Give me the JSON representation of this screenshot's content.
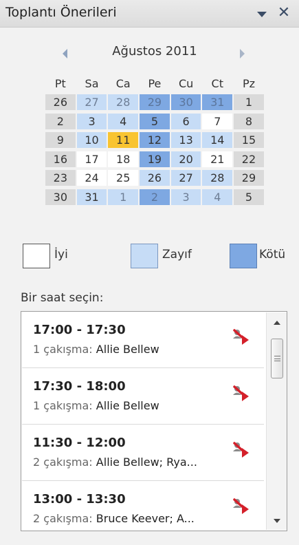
{
  "pane": {
    "title": "Toplantı Önerileri",
    "close_glyph": "✕"
  },
  "calendar": {
    "month_label": "Ağustos 2011",
    "weekdays": [
      "Pt",
      "Sa",
      "Ca",
      "Pe",
      "Cu",
      "Ct",
      "Pz"
    ],
    "weeks": [
      [
        {
          "day": "26",
          "status": "gray",
          "out": true
        },
        {
          "day": "27",
          "status": "fair",
          "out": true
        },
        {
          "day": "28",
          "status": "fair",
          "out": true
        },
        {
          "day": "29",
          "status": "poor",
          "out": true
        },
        {
          "day": "30",
          "status": "poor",
          "out": true
        },
        {
          "day": "31",
          "status": "poor",
          "out": true
        },
        {
          "day": "1",
          "status": "gray",
          "out": false
        }
      ],
      [
        {
          "day": "2",
          "status": "gray",
          "out": false
        },
        {
          "day": "3",
          "status": "fair",
          "out": false
        },
        {
          "day": "4",
          "status": "fair",
          "out": false
        },
        {
          "day": "5",
          "status": "poor",
          "out": false
        },
        {
          "day": "6",
          "status": "fair",
          "out": false
        },
        {
          "day": "7",
          "status": "good",
          "out": false
        },
        {
          "day": "8",
          "status": "gray",
          "out": false
        }
      ],
      [
        {
          "day": "9",
          "status": "gray",
          "out": false
        },
        {
          "day": "10",
          "status": "fair",
          "out": false
        },
        {
          "day": "11",
          "status": "selected",
          "out": false
        },
        {
          "day": "12",
          "status": "poor",
          "out": false
        },
        {
          "day": "13",
          "status": "fair",
          "out": false
        },
        {
          "day": "14",
          "status": "fair",
          "out": false
        },
        {
          "day": "15",
          "status": "gray",
          "out": false
        }
      ],
      [
        {
          "day": "16",
          "status": "gray",
          "out": false
        },
        {
          "day": "17",
          "status": "good",
          "out": false
        },
        {
          "day": "18",
          "status": "good",
          "out": false
        },
        {
          "day": "19",
          "status": "poor",
          "out": false
        },
        {
          "day": "20",
          "status": "fair",
          "out": false
        },
        {
          "day": "21",
          "status": "good",
          "out": false
        },
        {
          "day": "22",
          "status": "gray",
          "out": false
        }
      ],
      [
        {
          "day": "23",
          "status": "gray",
          "out": false
        },
        {
          "day": "24",
          "status": "good",
          "out": false
        },
        {
          "day": "25",
          "status": "good",
          "out": false
        },
        {
          "day": "26",
          "status": "fair",
          "out": false
        },
        {
          "day": "27",
          "status": "fair",
          "out": false
        },
        {
          "day": "28",
          "status": "fair",
          "out": false
        },
        {
          "day": "29",
          "status": "gray",
          "out": false
        }
      ],
      [
        {
          "day": "30",
          "status": "gray",
          "out": false
        },
        {
          "day": "31",
          "status": "fair",
          "out": false
        },
        {
          "day": "1",
          "status": "fair",
          "out": true
        },
        {
          "day": "2",
          "status": "poor",
          "out": true
        },
        {
          "day": "3",
          "status": "fair",
          "out": true
        },
        {
          "day": "4",
          "status": "fair",
          "out": true
        },
        {
          "day": "5",
          "status": "gray",
          "out": true
        }
      ]
    ]
  },
  "legend": {
    "good": "İyi",
    "fair": "Zayıf",
    "poor": "Kötü"
  },
  "time_section": {
    "label": "Bir saat seçin:",
    "items": [
      {
        "time": "17:00 - 17:30",
        "conflict_count": "1 çakışma:",
        "attendees": "Allie Bellew"
      },
      {
        "time": "17:30 - 18:00",
        "conflict_count": "1 çakışma:",
        "attendees": "Allie Bellew"
      },
      {
        "time": "11:30 - 12:00",
        "conflict_count": "2 çakışma:",
        "attendees": "Allie Bellew; Rya..."
      },
      {
        "time": "13:00 - 13:30",
        "conflict_count": "2 çakışma:",
        "attendees": "Bruce Keever; A..."
      }
    ]
  },
  "colors": {
    "good": "#ffffff",
    "fair": "#c6dcf6",
    "poor": "#7ea8e2",
    "selected": "#f9c431"
  }
}
